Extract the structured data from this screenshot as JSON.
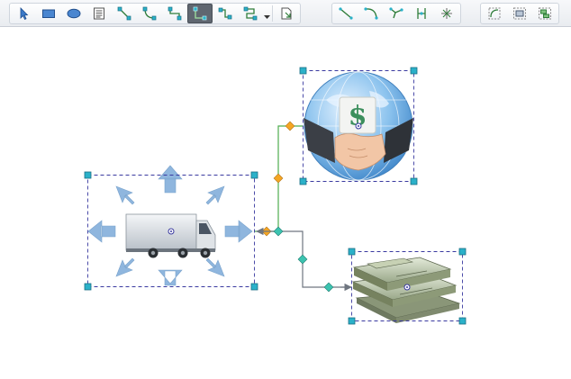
{
  "toolbar": {
    "groups": [
      {
        "name": "drawing-tools",
        "items": [
          "pointer-icon",
          "rectangle-icon",
          "ellipse-icon",
          "text-block-icon",
          "connector-straight-icon",
          "connector-elbow-icon",
          "connector-step-icon",
          "connector-orthogonal-icon",
          "connector-curved-icon",
          "connector-tree-icon",
          "dropdown-arrow-icon",
          "insert-shape-icon"
        ],
        "active": "connector-orthogonal-icon"
      },
      {
        "name": "line-tools",
        "items": [
          "line-straight-icon",
          "line-arc-icon",
          "line-bezier-icon",
          "line-vertical-icon",
          "line-split-icon"
        ]
      },
      {
        "name": "layout-tools",
        "items": [
          "auto-route-icon",
          "fit-shape-icon",
          "align-shape-icon"
        ]
      }
    ]
  },
  "colors": {
    "selection_border": "#3a3aa0",
    "handle_fill": "#2bb1c9",
    "handle_stroke": "#1b6f84",
    "connector_green": "#4fae4f",
    "connector_gray": "#6f7680",
    "connector_diamond_orange": "#f5a623",
    "connector_diamond_teal": "#3cc3b0",
    "arrow_blue": "#8fb6de"
  },
  "shapes": [
    {
      "name": "truck-with-arrows",
      "image": "delivery-truck-icon"
    },
    {
      "name": "globe-handshake",
      "image": "globe-handshake-dollar-icon"
    },
    {
      "name": "money-stack",
      "image": "cash-stack-icon"
    }
  ],
  "labels": {
    "dollar_sign": "$"
  }
}
